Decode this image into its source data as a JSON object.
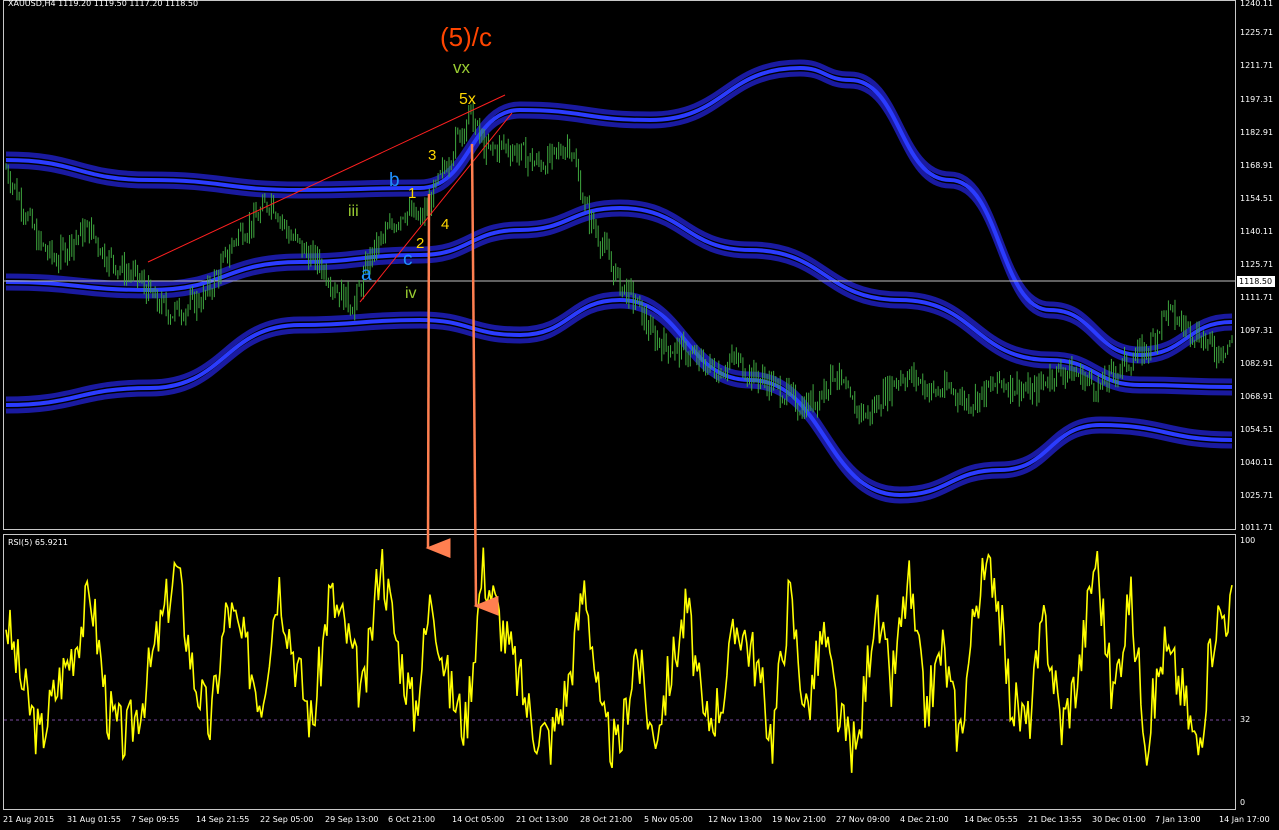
{
  "header": {
    "symbol_title": "XAUUSD,H4  1119.20 1119.50 1117.20 1118.50",
    "rsi_title": "RSI(5) 65.9211"
  },
  "price_axis": [
    "1240.11",
    "1225.71",
    "1211.71",
    "1197.31",
    "1182.91",
    "1168.91",
    "1154.51",
    "1140.11",
    "1125.71",
    "1111.71",
    "1097.31",
    "1082.91",
    "1068.91",
    "1054.51",
    "1040.11",
    "1025.71",
    "1011.71"
  ],
  "current_price": "1118.50",
  "rsi_axis": [
    "100",
    "32",
    "0"
  ],
  "time_axis": [
    "21 Aug 2015",
    "31 Aug 01:55",
    "7 Sep 09:55",
    "14 Sep 21:55",
    "22 Sep 05:00",
    "29 Sep 13:00",
    "6 Oct 21:00",
    "14 Oct 05:00",
    "21 Oct 13:00",
    "28 Oct 21:00",
    "5 Nov 05:00",
    "12 Nov 13:00",
    "19 Nov 21:00",
    "27 Nov 09:00",
    "4 Dec 21:00",
    "14 Dec 05:55",
    "21 Dec 13:55",
    "30 Dec 01:00",
    "7 Jan 13:00",
    "14 Jan 17:00"
  ],
  "wave_labels": {
    "top": "(5)/c",
    "vx": "vx",
    "fivex": "5x",
    "three": "3",
    "b": "b",
    "one": "1",
    "iii": "iii",
    "four": "4",
    "two": "2",
    "c": "c",
    "a": "a",
    "iv": "iv"
  },
  "colors": {
    "background": "#000000",
    "candles": "#3fa83f",
    "bands": "#1a1aa0",
    "band_core": "#2b3cff",
    "rsi_line": "#ffff00",
    "level_line": "#7a4aa0",
    "arrow": "#ff7f50",
    "trendline": "#ff2020",
    "label_orange": "#ff4500",
    "label_green": "#9acd32",
    "label_yellow": "#ffd700",
    "label_blue": "#1e90ff"
  },
  "chart_data": [
    {
      "type": "line",
      "title": "XAUUSD,H4  1119.20 1119.50 1117.20 1118.50",
      "series": [
        {
          "name": "XAUUSD",
          "values": [
            1168,
            1152,
            1135,
            1128,
            1137,
            1142,
            1130,
            1124,
            1120,
            1110,
            1105,
            1108,
            1112,
            1125,
            1140,
            1145,
            1155,
            1140,
            1132,
            1126,
            1115,
            1108,
            1130,
            1140,
            1150,
            1145,
            1160,
            1178,
            1192,
            1175,
            1178,
            1175,
            1170,
            1172,
            1180,
            1150,
            1135,
            1118,
            1110,
            1095,
            1090,
            1088,
            1083,
            1080,
            1085,
            1078,
            1075,
            1070,
            1064,
            1068,
            1080,
            1065,
            1060,
            1070,
            1078,
            1076,
            1070,
            1072,
            1066,
            1070,
            1075,
            1073,
            1070,
            1078,
            1080,
            1077,
            1072,
            1080,
            1085,
            1090,
            1106,
            1100,
            1096,
            1088,
            1093
          ]
        }
      ],
      "ylim": [
        1011.71,
        1240.11
      ]
    },
    {
      "type": "line",
      "title": "RSI(5) 65.9211",
      "series": [
        {
          "name": "RSI(5)",
          "values": [
            70,
            45,
            25,
            45,
            60,
            80,
            35,
            25,
            40,
            65,
            90,
            50,
            30,
            75,
            60,
            40,
            85,
            55,
            30,
            80,
            65,
            40,
            95,
            60,
            35,
            80,
            45,
            30,
            90,
            70,
            50,
            30,
            25,
            45,
            85,
            30,
            20,
            60,
            25,
            50,
            75,
            30,
            40,
            70,
            55,
            25,
            80,
            35,
            65,
            30,
            20,
            75,
            45,
            85,
            35,
            60,
            25,
            80,
            90,
            40,
            30,
            70,
            30,
            50,
            95,
            40,
            80,
            25,
            60,
            45,
            20,
            70,
            75
          ],
          "levels": [
            32
          ]
        }
      ],
      "ylim": [
        0,
        100
      ]
    }
  ]
}
